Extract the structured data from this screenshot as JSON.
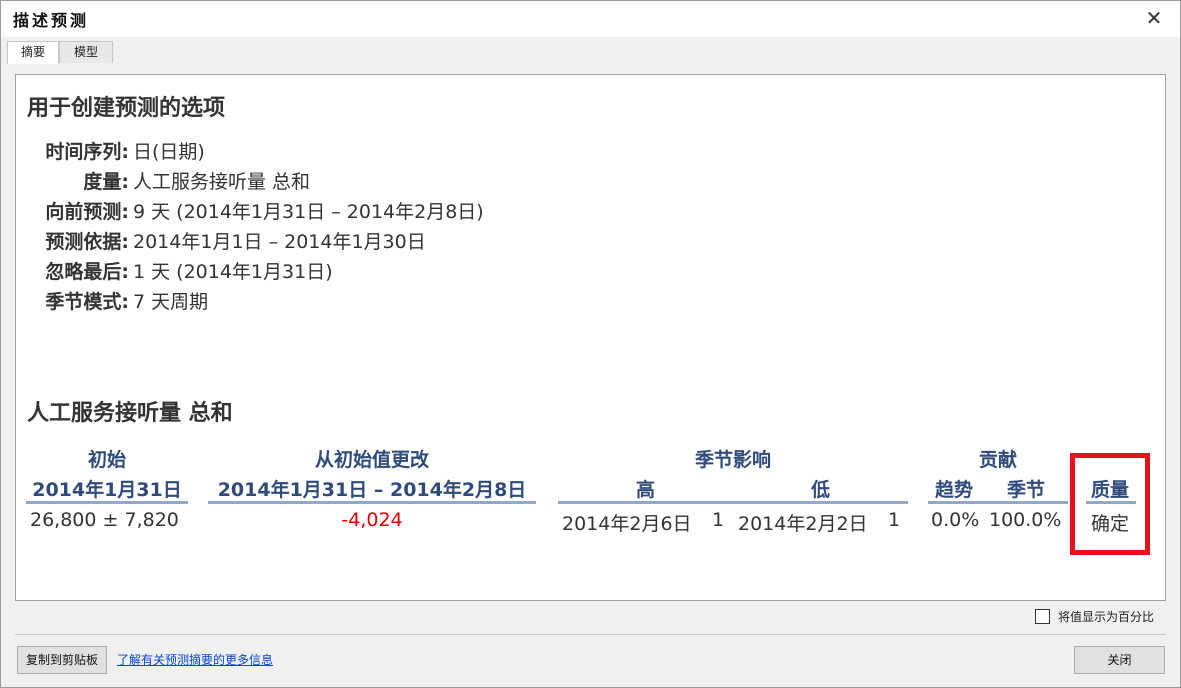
{
  "window": {
    "title": "描述预测",
    "close_glyph": "✕"
  },
  "tabs": [
    {
      "label": "摘要",
      "active": true
    },
    {
      "label": "模型",
      "active": false
    }
  ],
  "options": {
    "heading": "用于创建预测的选项",
    "rows": [
      {
        "key": "时间序列:",
        "value": "日(日期)"
      },
      {
        "key": "度量:",
        "value": "人工服务接听量 总和"
      },
      {
        "key": "向前预测:",
        "value": "9 天 (2014年1月31日 – 2014年2月8日)"
      },
      {
        "key": "预测依据:",
        "value": "2014年1月1日 – 2014年1月30日"
      },
      {
        "key": "忽略最后:",
        "value": "1 天 (2014年1月31日)"
      },
      {
        "key": "季节模式:",
        "value": "7 天周期"
      }
    ]
  },
  "measure": {
    "heading": "人工服务接听量 总和",
    "col_initial": {
      "title": "初始",
      "sub": "2014年1月31日",
      "value": "26,800 ±  7,820"
    },
    "col_change": {
      "title": "从初始值更改",
      "sub": "2014年1月31日 – 2014年2月8日",
      "value": "-4,024"
    },
    "col_season": {
      "title": "季节影响",
      "high_label": "高",
      "low_label": "低",
      "high_date": "2014年2月6日",
      "high_val": "1",
      "low_date": "2014年2月2日",
      "low_val": "1"
    },
    "col_contrib": {
      "title": "贡献",
      "trend_label": "趋势",
      "season_label": "季节",
      "trend_val": "0.0%",
      "season_val": "100.0%"
    },
    "col_quality": {
      "title": "质量",
      "value": "确定"
    }
  },
  "footer": {
    "percent_checkbox_label": "将值显示为百分比",
    "percent_checked": false,
    "copy_button": "复制到剪贴板",
    "info_link": "了解有关预测摘要的更多信息",
    "close_button": "关闭"
  },
  "colors": {
    "header_blue": "#2f4b7c",
    "negative_red": "#e00000",
    "highlight_red": "#e8101a"
  }
}
